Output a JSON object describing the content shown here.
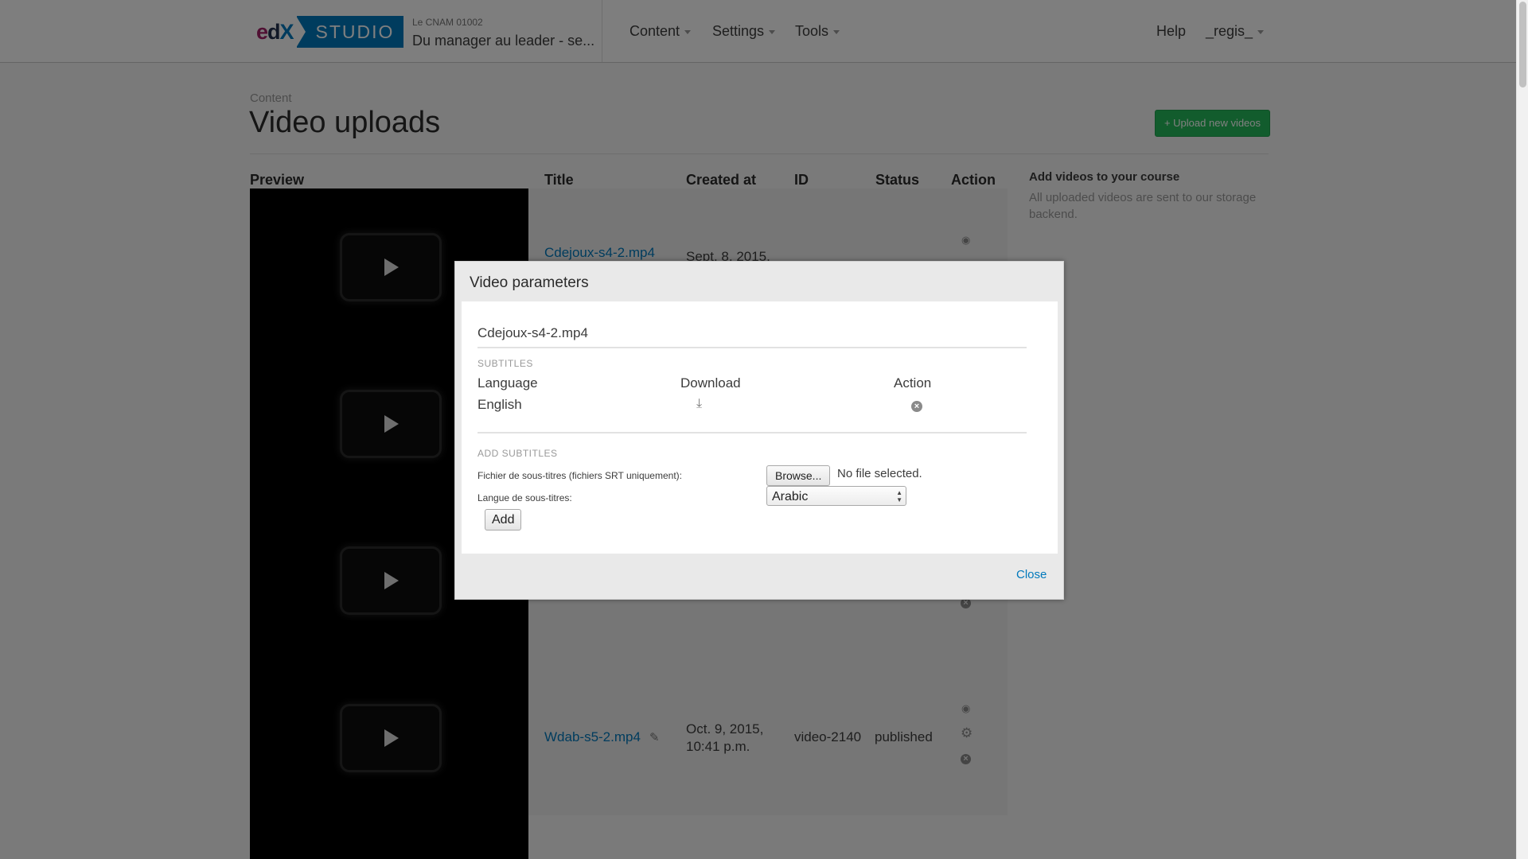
{
  "header": {
    "logo_edx": [
      "e",
      "d",
      "X"
    ],
    "logo_studio": "STUDIO",
    "course_org": "Le CNAM  01002",
    "course_title": "Du manager au leader - se...",
    "nav": {
      "content": "Content",
      "settings": "Settings",
      "tools": "Tools"
    },
    "help": "Help",
    "user": "_regis_"
  },
  "page": {
    "breadcrumb": "Content",
    "title": "Video uploads",
    "upload_button": "+ Upload new videos"
  },
  "table": {
    "headers": {
      "preview": "Preview",
      "title": "Title",
      "created": "Created at",
      "id": "ID",
      "status": "Status",
      "action": "Action"
    },
    "rows": [
      {
        "title": "Cdejoux-s4-2.mp4",
        "created": "Sept. 8, 2015,",
        "id": "",
        "status": ""
      },
      {
        "title": "",
        "created": "",
        "id": "",
        "status": ""
      },
      {
        "title": "",
        "created": "",
        "id": "",
        "status": ""
      },
      {
        "title": "Wdab-s5-2.mp4",
        "created_line1": "Oct. 9, 2015,",
        "created_line2": "10:41 p.m.",
        "id": "video-2140",
        "status": "published"
      }
    ]
  },
  "sidebar": {
    "title": "Add videos to your course",
    "text": "All uploaded videos are sent to our storage backend."
  },
  "modal": {
    "title": "Video parameters",
    "filename": "Cdejoux-s4-2.mp4",
    "subtitles_heading": "SUBTITLES",
    "columns": {
      "language": "Language",
      "download": "Download",
      "action": "Action"
    },
    "subtitle_rows": [
      {
        "language": "English"
      }
    ],
    "add_heading": "ADD SUBTITLES",
    "file_label": "Fichier de sous-titres (fichiers SRT uniquement):",
    "browse_button": "Browse...",
    "file_status": "No file selected.",
    "lang_label": "Langue de sous-titres:",
    "lang_selected": "Arabic",
    "add_button": "Add",
    "close": "Close"
  },
  "colors": {
    "accent": "#0079bc",
    "upload_green": "#25b85a",
    "brand_magenta": "#a12066"
  },
  "icons": [
    "eye-icon",
    "gear-icon",
    "remove-icon",
    "pencil-icon",
    "download-icon",
    "play-icon",
    "chevron-down-icon"
  ]
}
